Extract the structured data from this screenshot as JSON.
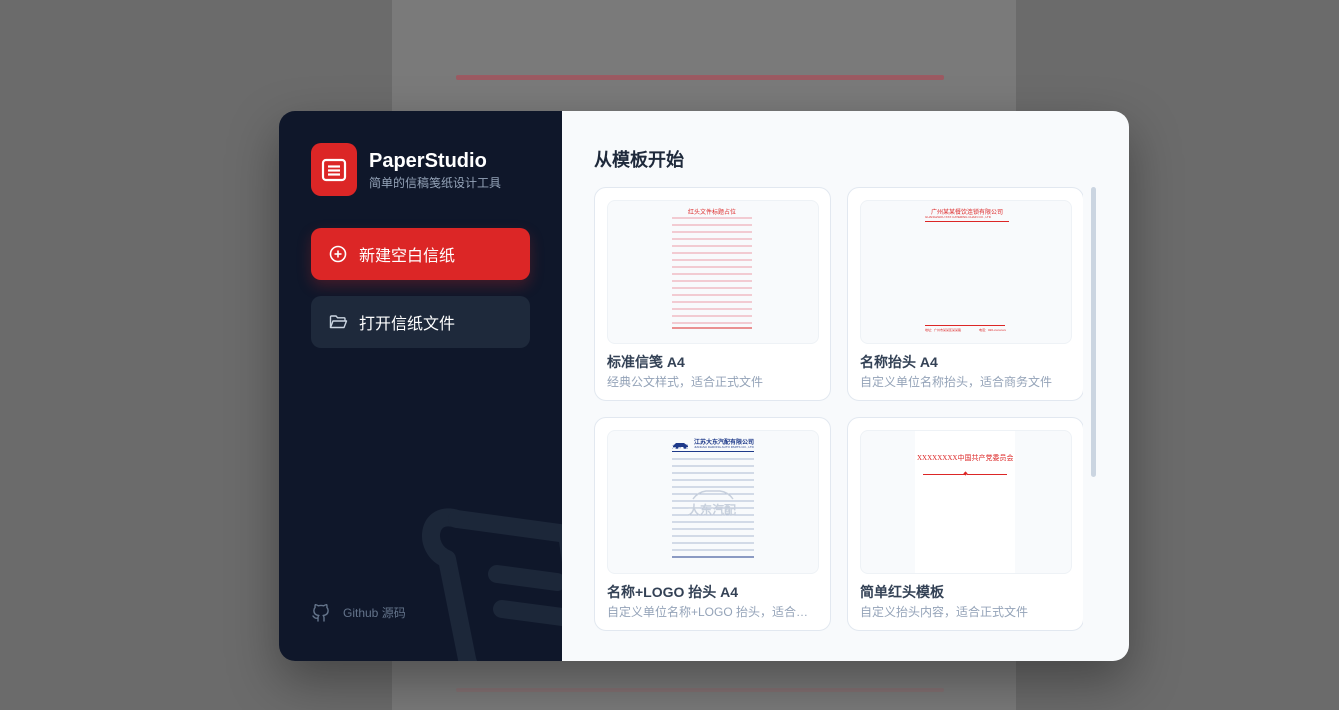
{
  "brand": {
    "name": "PaperStudio",
    "subtitle": "简单的信稿笺纸设计工具",
    "logo_icon": "document-lines-icon",
    "accent": "#dc2626"
  },
  "actions": {
    "new_label": "新建空白信纸",
    "new_icon": "plus-circle-icon",
    "open_label": "打开信纸文件",
    "open_icon": "folder-open-icon"
  },
  "footer": {
    "github_label": "Github 源码",
    "github_icon": "github-icon"
  },
  "main": {
    "title": "从模板开始"
  },
  "templates": [
    {
      "title": "标准信笺 A4",
      "desc": "经典公文样式，适合正式文件",
      "thumb_header": "红头文件标题占位"
    },
    {
      "title": "名称抬头 A4",
      "desc": "自定义单位名称抬头，适合商务文件",
      "thumb_header": "广州某某餐饮连锁有限公司",
      "thumb_subheader": "GUANGZHOU XXX CATERING CHAIN CO., LTD",
      "thumb_footer_left": "地址：广州市某某区某某路",
      "thumb_footer_right": "电话：020-xxxxxxxx"
    },
    {
      "title": "名称+LOGO 抬头 A4",
      "desc": "自定义单位名称+LOGO 抬头，适合商务文件",
      "thumb_header": "江苏大东汽配有限公司",
      "thumb_subheader": "JIANGSU DADONG AUTO PARTS CO., LTD",
      "thumb_logo": "大东汽配",
      "thumb_watermark": "大东汽配"
    },
    {
      "title": "简单红头模板",
      "desc": "自定义抬头内容，适合正式文件",
      "thumb_header": "XXXXXXXX中国共产党委员会文件"
    }
  ]
}
